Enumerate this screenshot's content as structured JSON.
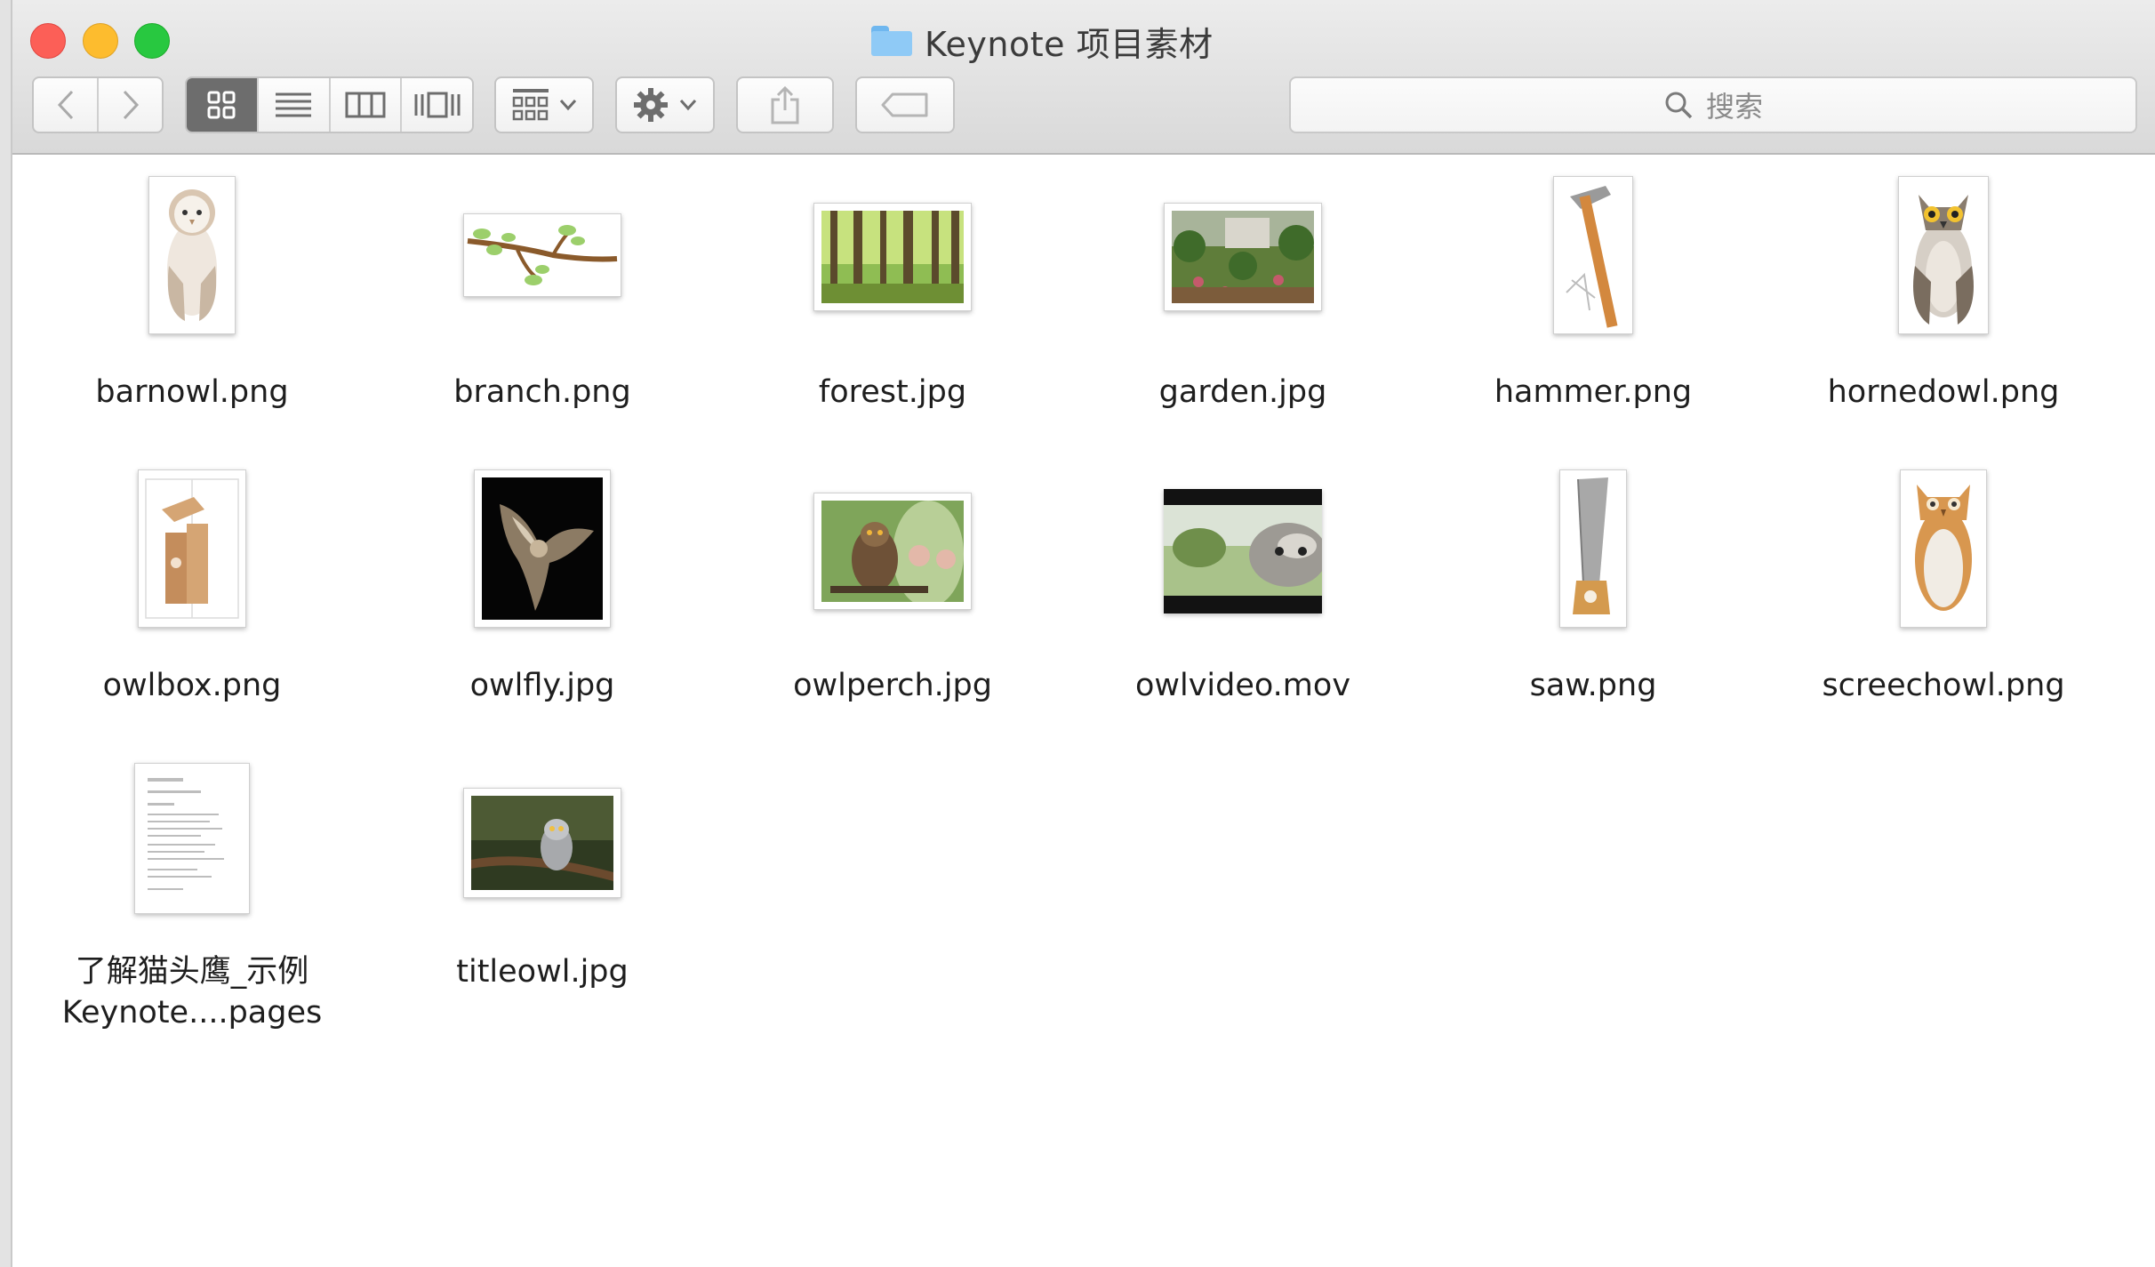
{
  "window": {
    "title": "Keynote 项目素材",
    "colors": {
      "close": "#fc5f57",
      "minimize": "#fdbc2e",
      "zoom": "#28c840",
      "folder": "#8fcaf6"
    }
  },
  "toolbar": {
    "nav": {
      "back_icon": "chevron-left-icon",
      "forward_icon": "chevron-right-icon"
    },
    "view_modes": [
      "icon-view",
      "list-view",
      "column-view",
      "cover-flow-view"
    ],
    "active_view": "icon-view",
    "arrange_icon": "arrange-grid-icon",
    "action_icon": "gear-icon",
    "share_icon": "share-icon",
    "tag_icon": "tag-icon"
  },
  "search": {
    "icon": "search-icon",
    "placeholder": "搜索"
  },
  "files": [
    {
      "name": "barnowl.png",
      "kind": "barnowl"
    },
    {
      "name": "branch.png",
      "kind": "branch"
    },
    {
      "name": "forest.jpg",
      "kind": "forest"
    },
    {
      "name": "garden.jpg",
      "kind": "garden"
    },
    {
      "name": "hammer.png",
      "kind": "hammer"
    },
    {
      "name": "hornedowl.png",
      "kind": "hornedowl"
    },
    {
      "name": "owlbox.png",
      "kind": "owlbox"
    },
    {
      "name": "owlfly.jpg",
      "kind": "owlfly"
    },
    {
      "name": "owlperch.jpg",
      "kind": "owlperch"
    },
    {
      "name": "owlvideo.mov",
      "kind": "owlvideo"
    },
    {
      "name": "saw.png",
      "kind": "saw"
    },
    {
      "name": "screechowl.png",
      "kind": "screechowl"
    },
    {
      "name": "了解猫头鹰_示例",
      "name_line2": "Keynote....pages",
      "kind": "pages"
    },
    {
      "name": "titleowl.jpg",
      "kind": "titleowl"
    }
  ]
}
